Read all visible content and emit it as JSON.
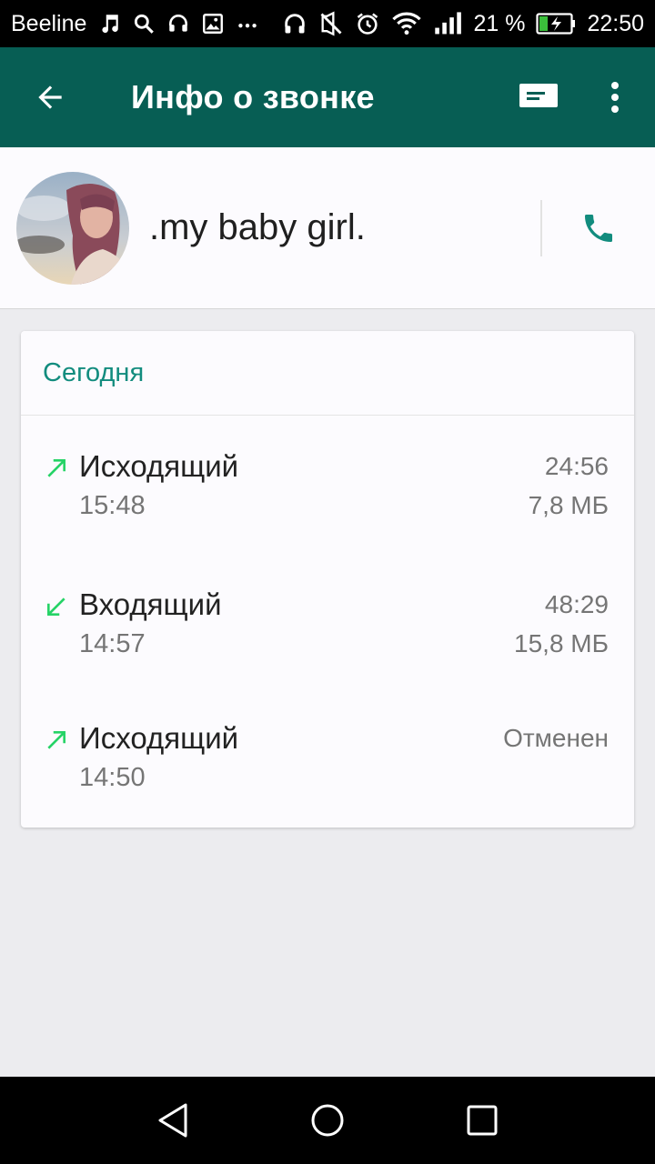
{
  "status_bar": {
    "carrier": "Beeline",
    "battery_percent": "21 %",
    "time": "22:50",
    "left_icons": [
      "music-icon",
      "search-icon",
      "headset-icon",
      "image-icon",
      "more-notifications-icon"
    ],
    "right_icons": [
      "headphones-icon",
      "vibrate-off-icon",
      "alarm-icon",
      "wifi-icon",
      "signal-icon",
      "battery-charging-icon"
    ]
  },
  "app_bar": {
    "title": "Инфо о звонке",
    "back_icon": "arrow-back-icon",
    "message_icon": "message-icon",
    "more_icon": "more-vert-icon"
  },
  "contact": {
    "name": ".my baby girl.",
    "call_icon": "phone-icon"
  },
  "call_log": {
    "section_title": "Сегодня",
    "calls": [
      {
        "direction": "outgoing",
        "type": "Исходящий",
        "time": "15:48",
        "duration": "24:56",
        "size": "7,8 МБ"
      },
      {
        "direction": "incoming",
        "type": "Входящий",
        "time": "14:57",
        "duration": "48:29",
        "size": "15,8 МБ"
      },
      {
        "direction": "outgoing",
        "type": "Исходящий",
        "time": "14:50",
        "duration": "Отменен",
        "size": ""
      }
    ]
  },
  "colors": {
    "primary_dark": "#075e54",
    "accent_teal": "#128c7e",
    "call_green": "#25d366",
    "secondary_text": "#757575"
  },
  "nav_bar": {
    "icons": [
      "nav-back-icon",
      "nav-home-icon",
      "nav-recents-icon"
    ]
  }
}
